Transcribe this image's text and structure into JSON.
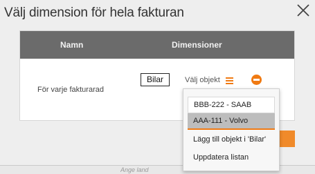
{
  "dialog": {
    "title": "Välj dimension för hela fakturan",
    "close_icon": "close-icon"
  },
  "table": {
    "headers": {
      "name": "Namn",
      "dimensions": "Dimensioner"
    },
    "row": {
      "label": "För varje fakturarad",
      "tag": "Bilar",
      "select_label": "Välj objekt",
      "menu_icon": "hamburger-icon",
      "remove_icon": "minus-circle-icon"
    }
  },
  "dropdown": {
    "options": [
      {
        "label": "BBB-222 - SAAB"
      },
      {
        "label": "AAA-111 - Volvo",
        "selected": true
      }
    ],
    "add_label": "Lägg till objekt i 'Bilar'",
    "refresh_label": "Uppdatera listan"
  },
  "footer": {
    "text": "Ange land"
  },
  "colors": {
    "accent": "#f07a12",
    "header_bg": "#6b6b6b",
    "selected_bg": "#bdbdbd"
  }
}
